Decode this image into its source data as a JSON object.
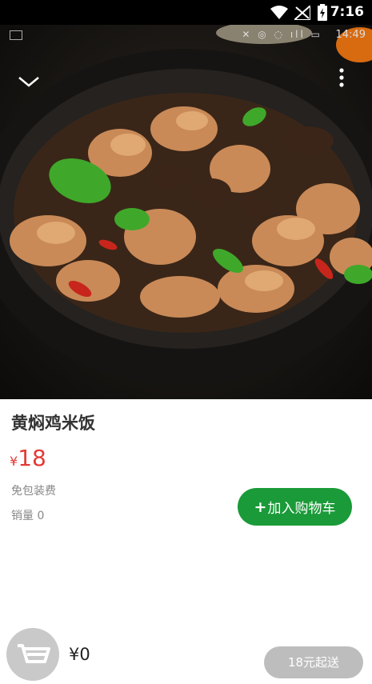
{
  "status_bar": {
    "time": "7:16"
  },
  "photo_status": {
    "time": "14:49"
  },
  "product": {
    "name": "黄焖鸡米饭",
    "currency": "¥",
    "price": "18",
    "packaging": "免包装费",
    "sales": "销量 0"
  },
  "actions": {
    "add_to_cart": "加入购物车",
    "add_plus": "+"
  },
  "cart": {
    "total": "¥0",
    "min_order": "18元起送"
  },
  "colors": {
    "accent_green": "#1a9a38",
    "price_red": "#e53935"
  },
  "icons": [
    "wifi-icon",
    "signal-icon",
    "battery-icon",
    "chevron-down-icon",
    "more-vertical-icon",
    "shopping-cart-icon"
  ]
}
